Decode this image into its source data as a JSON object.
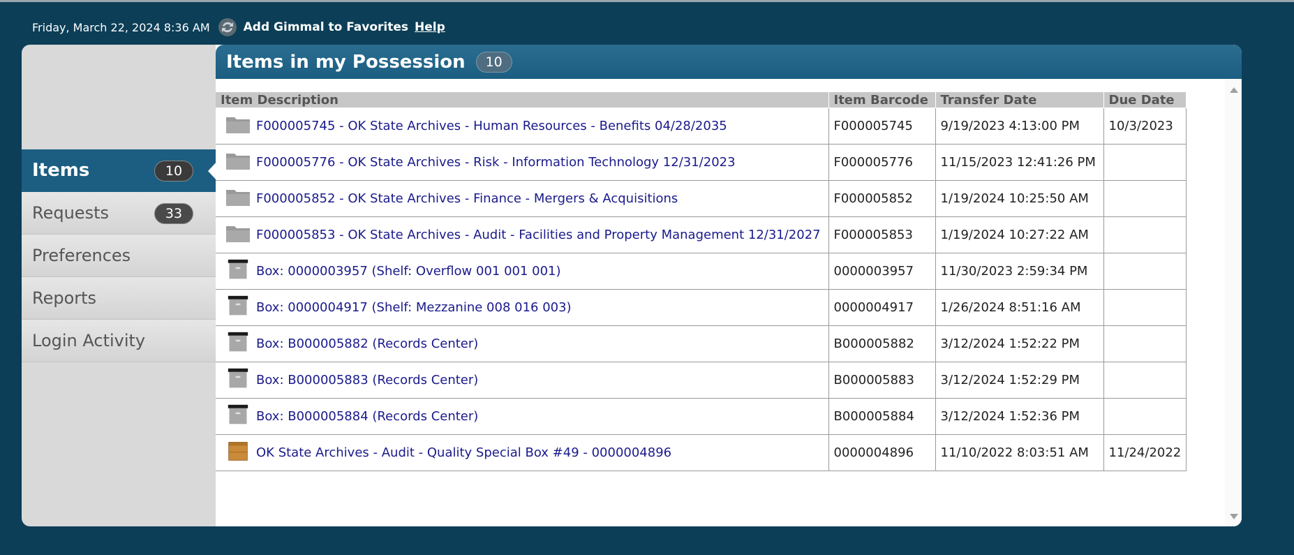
{
  "topbar": {
    "datetime": "Friday, March 22, 2024 8:36 AM",
    "add_favorites": "Add Gimmal to Favorites",
    "help": "Help"
  },
  "sidebar": {
    "items": [
      {
        "label": "Items",
        "badge": "10",
        "active": true
      },
      {
        "label": "Requests",
        "badge": "33"
      },
      {
        "label": "Preferences"
      },
      {
        "label": "Reports"
      },
      {
        "label": "Login Activity"
      }
    ]
  },
  "panel": {
    "title": "Items in my Possession",
    "count": "10"
  },
  "table": {
    "columns": [
      "Item Description",
      "Item Barcode",
      "Transfer Date",
      "Due Date"
    ],
    "rows": [
      {
        "icon": "folder-icon",
        "description": "F000005745 - OK State Archives - Human Resources - Benefits 04/28/2035",
        "barcode": "F000005745",
        "transfer": "9/19/2023 4:13:00 PM",
        "due": "10/3/2023"
      },
      {
        "icon": "folder-icon",
        "description": "F000005776 - OK State Archives - Risk - Information Technology 12/31/2023",
        "barcode": "F000005776",
        "transfer": "11/15/2023 12:41:26 PM",
        "due": ""
      },
      {
        "icon": "folder-icon",
        "description": "F000005852 - OK State Archives - Finance - Mergers & Acquisitions",
        "barcode": "F000005852",
        "transfer": "1/19/2024 10:25:50 AM",
        "due": ""
      },
      {
        "icon": "folder-icon",
        "description": "F000005853 - OK State Archives - Audit - Facilities and Property Management 12/31/2027",
        "barcode": "F000005853",
        "transfer": "1/19/2024 10:27:22 AM",
        "due": ""
      },
      {
        "icon": "box-icon",
        "description": "Box: 0000003957 (Shelf: Overflow 001 001 001)",
        "barcode": "0000003957",
        "transfer": "11/30/2023 2:59:34 PM",
        "due": ""
      },
      {
        "icon": "box-icon",
        "description": "Box: 0000004917 (Shelf: Mezzanine 008 016 003)",
        "barcode": "0000004917",
        "transfer": "1/26/2024 8:51:16 AM",
        "due": ""
      },
      {
        "icon": "box-icon",
        "description": "Box: B000005882 (Records Center)",
        "barcode": "B000005882",
        "transfer": "3/12/2024 1:52:22 PM",
        "due": ""
      },
      {
        "icon": "box-icon",
        "description": "Box: B000005883 (Records Center)",
        "barcode": "B000005883",
        "transfer": "3/12/2024 1:52:29 PM",
        "due": ""
      },
      {
        "icon": "box-icon",
        "description": "Box: B000005884 (Records Center)",
        "barcode": "B000005884",
        "transfer": "3/12/2024 1:52:36 PM",
        "due": ""
      },
      {
        "icon": "crate-icon",
        "description": "OK State Archives - Audit - Quality Special Box #49 - 0000004896",
        "barcode": "0000004896",
        "transfer": "11/10/2022 8:03:51 AM",
        "due": "11/24/2022"
      }
    ]
  }
}
